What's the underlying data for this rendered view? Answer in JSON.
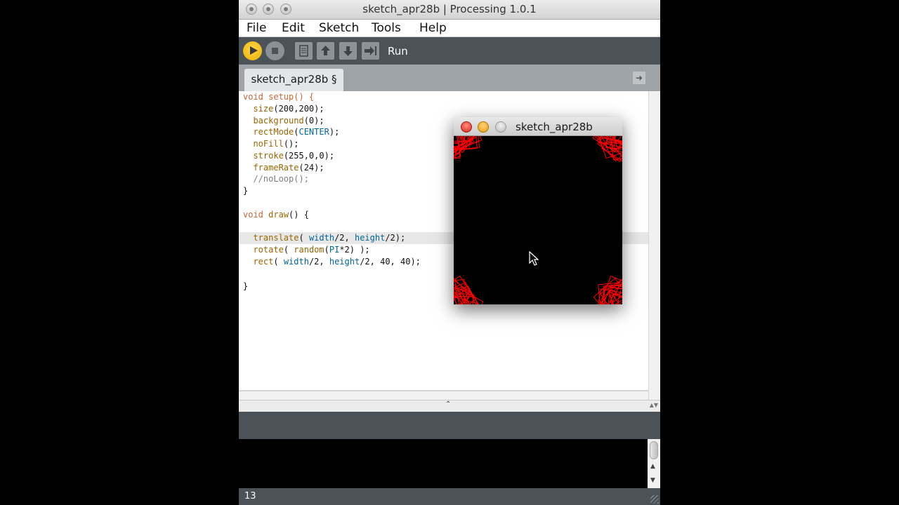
{
  "window": {
    "title": "sketch_apr28b | Processing 1.0.1"
  },
  "menu": [
    "File",
    "Edit",
    "Sketch",
    "Tools",
    "Help"
  ],
  "toolbar": {
    "hover_label": "Run",
    "buttons": [
      "run-button",
      "stop-button",
      "new-button",
      "open-button",
      "save-button",
      "export-button"
    ]
  },
  "tab": {
    "label": "sketch_apr28b §"
  },
  "code": {
    "l1": "void setup() {",
    "l2a": "  ",
    "l2f": "size",
    "l2b": "(200,200);",
    "l3f": "background",
    "l3b": "(0);",
    "l4f": "rectMode",
    "l4c": "CENTER",
    "l4b": ");",
    "l5f": "noFill",
    "l5b": "();",
    "l6f": "stroke",
    "l6b": "(255,0,0);",
    "l7f": "frameRate",
    "l7b": "(24);",
    "l8": "//noLoop();",
    "l9": "}",
    "l11k": "void",
    "l11f": "draw",
    "l11b": "() {",
    "l13f": "translate",
    "l13a": "( ",
    "l13c1": "width",
    "l13m": "/2, ",
    "l13c2": "height",
    "l13e": "/2);",
    "l14f": "rotate",
    "l14a": "( ",
    "l14f2": "random",
    "l14p": "(",
    "l14c": "PI",
    "l14e": "*2) );",
    "l15f": "rect",
    "l15a": "( ",
    "l15c1": "width",
    "l15m": "/2, ",
    "l15c2": "height",
    "l15e": "/2, 40, 40);",
    "l17": "}"
  },
  "status": {
    "line_number": "13"
  },
  "sketch_window": {
    "title": "sketch_apr28b",
    "stroke_color": "#ff0000",
    "background_color": "#000000"
  }
}
